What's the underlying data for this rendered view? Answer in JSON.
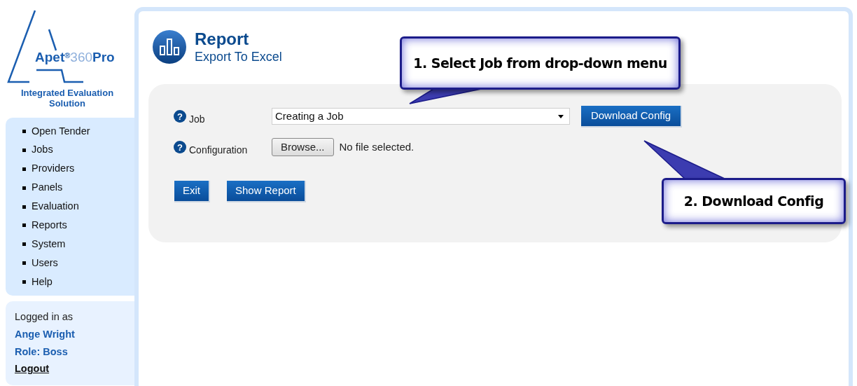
{
  "logo": {
    "name": "Apet",
    "mark": "®",
    "number": "360",
    "suffix": "Pro",
    "tagline": "Integrated Evaluation Solution"
  },
  "sidebar": {
    "items": [
      {
        "label": "Open Tender"
      },
      {
        "label": "Jobs"
      },
      {
        "label": "Providers"
      },
      {
        "label": "Panels"
      },
      {
        "label": "Evaluation"
      },
      {
        "label": "Reports"
      },
      {
        "label": "System"
      },
      {
        "label": "Users"
      },
      {
        "label": "Help"
      }
    ]
  },
  "user_panel": {
    "caption": "Logged in as",
    "name": "Ange Wright",
    "role": "Role: Boss",
    "logout": "Logout"
  },
  "page": {
    "title": "Report",
    "subtitle": "Export To Excel"
  },
  "form": {
    "fields": [
      {
        "kind": "select",
        "help": "?",
        "label": "Job",
        "value": "Creating a Job",
        "button": "Download Config"
      },
      {
        "kind": "file",
        "help": "?",
        "label": "Configuration",
        "button": "Browse...",
        "status": "No file selected."
      }
    ],
    "buttons": [
      "Exit",
      "Show Report"
    ]
  },
  "callouts": [
    "1. Select Job from drop-down menu",
    "2. Download Config"
  ]
}
